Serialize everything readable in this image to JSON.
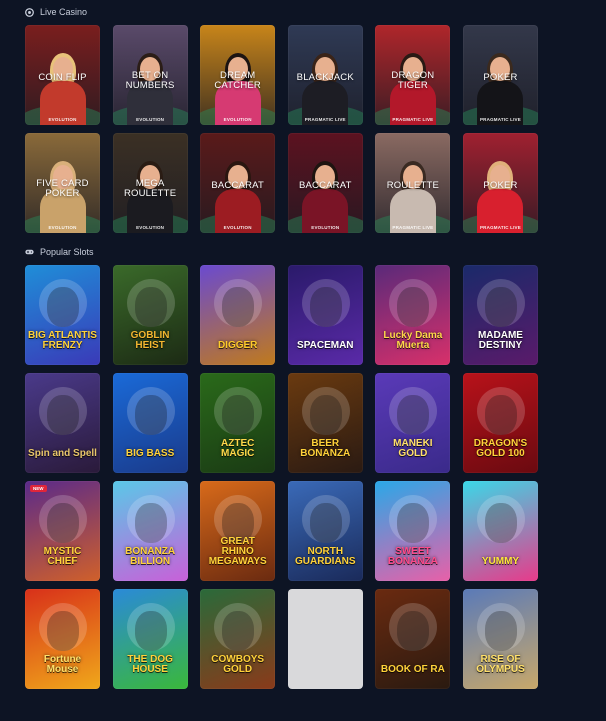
{
  "live_casino": {
    "title": "Live Casino",
    "icon": "chip-icon",
    "games": [
      {
        "name": "COIN FLIP",
        "provider": "EVOLUTION",
        "bg": "#7a1e1e",
        "hair": "#e8c27a",
        "outfit": "#c23a2c"
      },
      {
        "name": "BET ON NUMBERS",
        "provider": "EVOLUTION",
        "bg": "#5a4a6a",
        "hair": "#2b1d17",
        "outfit": "#2f2f3a"
      },
      {
        "name": "DREAM CATCHER",
        "provider": "EVOLUTION",
        "bg": "#c8851a",
        "hair": "#1c1412",
        "outfit": "#d63a72"
      },
      {
        "name": "BLACKJACK",
        "provider": "PRAGMATIC LIVE",
        "bg": "#2f3a55",
        "hair": "#3a2418",
        "outfit": "#1d1d24"
      },
      {
        "name": "DRAGON TIGER",
        "provider": "PRAGMATIC LIVE",
        "bg": "#b0262b",
        "hair": "#2a1a14",
        "outfit": "#b3182a"
      },
      {
        "name": "POKER",
        "provider": "PRAGMATIC LIVE",
        "bg": "#33384a",
        "hair": "#3b2a1e",
        "outfit": "#141418"
      },
      {
        "name": "FIVE CARD POKER",
        "provider": "EVOLUTION",
        "bg": "#8a6a3a",
        "hair": "#d9b07a",
        "outfit": "#c9a26a"
      },
      {
        "name": "MEGA ROULETTE",
        "provider": "EVOLUTION",
        "bg": "#3b3024",
        "hair": "#2a1c14",
        "outfit": "#1b1b20"
      },
      {
        "name": "BACCARAT",
        "provider": "EVOLUTION",
        "bg": "#5a1a1a",
        "hair": "#2a1610",
        "outfit": "#9c1c22"
      },
      {
        "name": "BACCARAT",
        "provider": "EVOLUTION",
        "bg": "#5c1220",
        "hair": "#1e1410",
        "outfit": "#7a1426"
      },
      {
        "name": "ROULETTE",
        "provider": "PRAGMATIC LIVE",
        "bg": "#8a6a62",
        "hair": "#3a2a22",
        "outfit": "#c8bab0"
      },
      {
        "name": "POKER",
        "provider": "PRAGMATIC LIVE",
        "bg": "#a02030",
        "hair": "#e0b07a",
        "outfit": "#d8202e"
      }
    ]
  },
  "popular_slots": {
    "title": "Popular Slots",
    "icon": "gamepad-icon",
    "games": [
      {
        "name": "BIG ATLANTIS FRENZY",
        "bg1": "#1f8ed8",
        "bg2": "#3a3ab8",
        "text": "#ffd23a",
        "badge": ""
      },
      {
        "name": "GOBLIN HEIST",
        "bg1": "#3a6a2a",
        "bg2": "#1c2a14",
        "text": "#f2b630",
        "badge": ""
      },
      {
        "name": "DIGGER",
        "bg1": "#6a4ad0",
        "bg2": "#c07a1c",
        "text": "#ffcc2a",
        "badge": ""
      },
      {
        "name": "SPACEMAN",
        "bg1": "#2a1a6a",
        "bg2": "#5a2aa8",
        "text": "#ffffff",
        "badge": ""
      },
      {
        "name": "Lucky Dama Muerta",
        "bg1": "#5a2a7a",
        "bg2": "#d8306a",
        "text": "#ffd84a",
        "badge": ""
      },
      {
        "name": "MADAME DESTINY",
        "bg1": "#1a2a6a",
        "bg2": "#5a1a6a",
        "text": "#ffffff",
        "badge": ""
      },
      {
        "name": "Spin and Spell",
        "bg1": "#4a3a8a",
        "bg2": "#2a1a3a",
        "text": "#e8c66a",
        "badge": ""
      },
      {
        "name": "BIG BASS",
        "bg1": "#1a6ad8",
        "bg2": "#1a3a8a",
        "text": "#ffd23a",
        "badge": ""
      },
      {
        "name": "AZTEC MAGIC",
        "bg1": "#2a6a1a",
        "bg2": "#1a3a14",
        "text": "#ffd84a",
        "badge": ""
      },
      {
        "name": "BEER BONANZA",
        "bg1": "#6a3a10",
        "bg2": "#2a1a12",
        "text": "#ffd23a",
        "badge": ""
      },
      {
        "name": "MANEKI GOLD",
        "bg1": "#5a3ab8",
        "bg2": "#3a2a8a",
        "text": "#ffe06a",
        "badge": ""
      },
      {
        "name": "DRAGON'S GOLD 100",
        "bg1": "#b8121a",
        "bg2": "#6a0a10",
        "text": "#ffd23a",
        "badge": ""
      },
      {
        "name": "MYSTIC CHIEF",
        "bg1": "#5a2a8a",
        "bg2": "#d0602a",
        "text": "#ffd23a",
        "badge": "NEW"
      },
      {
        "name": "BONANZA BILLION",
        "bg1": "#5ac8e8",
        "bg2": "#c860d8",
        "text": "#ffd23a",
        "badge": ""
      },
      {
        "name": "GREAT RHINO MEGAWAYS",
        "bg1": "#d86a1a",
        "bg2": "#6a2a10",
        "text": "#ffd23a",
        "badge": ""
      },
      {
        "name": "NORTH GUARDIANS",
        "bg1": "#3a6ab8",
        "bg2": "#1a2a5a",
        "text": "#ffd23a",
        "badge": ""
      },
      {
        "name": "SWEET BONANZA",
        "bg1": "#2aa8e8",
        "bg2": "#e860a8",
        "text": "#ff4a8a",
        "badge": ""
      },
      {
        "name": "YUMMY",
        "bg1": "#3ad8e8",
        "bg2": "#e83a8a",
        "text": "#ffe83a",
        "badge": ""
      },
      {
        "name": "Fortune Mouse",
        "bg1": "#d8301a",
        "bg2": "#f0a81a",
        "text": "#ffe06a",
        "badge": ""
      },
      {
        "name": "THE DOG HOUSE",
        "bg1": "#2a8ad8",
        "bg2": "#3ab83a",
        "text": "#ffd23a",
        "badge": ""
      },
      {
        "name": "COWBOYS GOLD",
        "bg1": "#2a6a3a",
        "bg2": "#8a3a1a",
        "text": "#ffd23a",
        "badge": ""
      },
      {
        "name": "",
        "bg1": "#d9d9db",
        "bg2": "#d9d9db",
        "text": "#d9d9db",
        "badge": ""
      },
      {
        "name": "BOOK OF RA",
        "bg1": "#6a2a10",
        "bg2": "#2a1a10",
        "text": "#ffd23a",
        "badge": ""
      },
      {
        "name": "RISE OF OLYMPUS",
        "bg1": "#5a7ab8",
        "bg2": "#c8a86a",
        "text": "#ffe06a",
        "badge": ""
      }
    ]
  }
}
